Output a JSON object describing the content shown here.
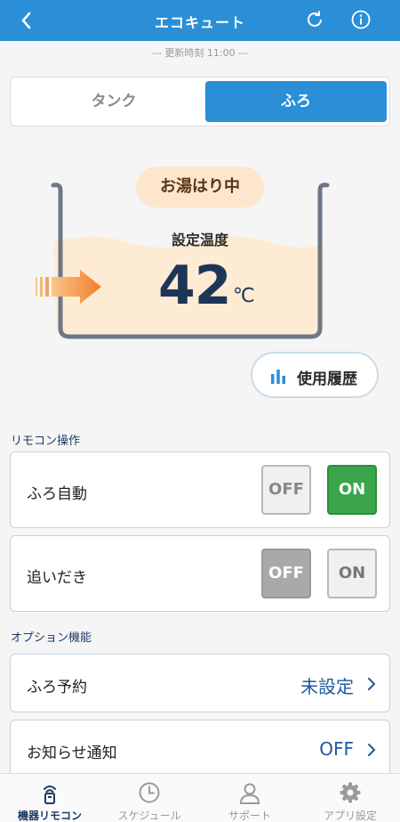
{
  "header": {
    "title": "エコキュート",
    "back_icon": "chevron-left-icon",
    "refresh_icon": "refresh-icon",
    "info_icon": "info-icon",
    "color": "#2a8fd6"
  },
  "update_time": "--- 更新時刻 11:00 ---",
  "tabs": [
    {
      "label": "タンク",
      "active": false
    },
    {
      "label": "ふろ",
      "active": true
    }
  ],
  "bath": {
    "status": "お湯はり中",
    "set_temp_label": "設定温度",
    "temp_value": "42",
    "temp_unit": "℃"
  },
  "history_button": {
    "label": "使用履歴",
    "icon": "bar-chart-icon"
  },
  "remote_section": {
    "title": "リモコン操作",
    "items": [
      {
        "label": "ふろ自動",
        "off_label": "OFF",
        "on_label": "ON",
        "state": "ON"
      },
      {
        "label": "追いだき",
        "off_label": "OFF",
        "on_label": "ON",
        "state": "OFF"
      }
    ]
  },
  "option_section": {
    "title": "オプション機能",
    "items": [
      {
        "label": "ふろ予約",
        "value": "未設定"
      },
      {
        "label": "お知らせ通知",
        "value": "OFF"
      }
    ]
  },
  "bottom_nav": [
    {
      "label": "機器リモコン",
      "icon": "remote-device-icon",
      "active": true
    },
    {
      "label": "スケジュール",
      "icon": "clock-icon",
      "active": false
    },
    {
      "label": "サポート",
      "icon": "person-icon",
      "active": false
    },
    {
      "label": "アプリ設定",
      "icon": "gear-icon",
      "active": false
    }
  ],
  "colors": {
    "accent": "#2a8fd6",
    "on_green": "#3aa54a",
    "water": "#fdebd3",
    "navy": "#1d3658"
  }
}
